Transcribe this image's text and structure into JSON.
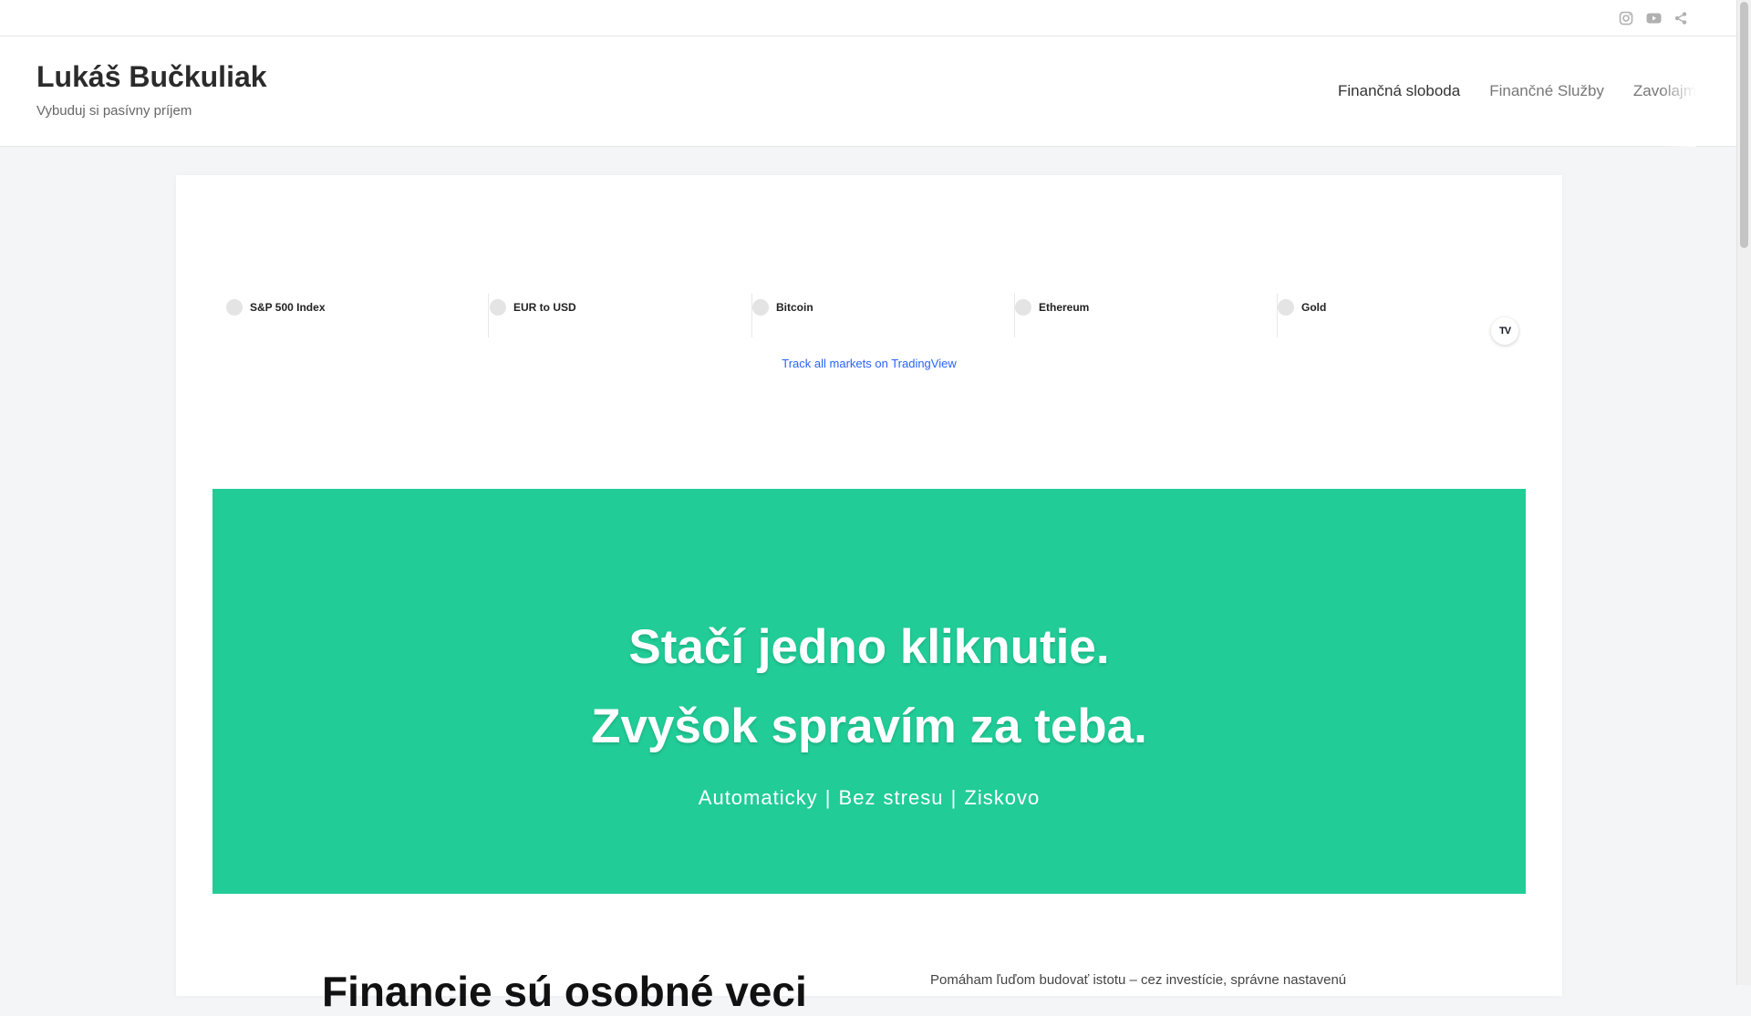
{
  "topbar": {
    "social": [
      {
        "icon": "instagram-icon"
      },
      {
        "icon": "youtube-icon"
      },
      {
        "icon": "share-icon"
      }
    ]
  },
  "header": {
    "title": "Lukáš Bučkuliak",
    "tagline": "Vybuduj si pasívny príjem",
    "nav": [
      {
        "label": "Finančná sloboda",
        "active": true
      },
      {
        "label": "Finančné Služby",
        "active": false
      },
      {
        "label": "Zavolajme si",
        "active": false
      }
    ]
  },
  "ticker": {
    "items": [
      {
        "label": "S&P 500 Index"
      },
      {
        "label": "EUR to USD"
      },
      {
        "label": "Bitcoin"
      },
      {
        "label": "Ethereum"
      },
      {
        "label": "Gold"
      }
    ],
    "logo": "TV",
    "link_text": "Track all markets on TradingView"
  },
  "hero": {
    "line1": "Stačí jedno kliknutie.",
    "line2": "Zvyšok spravím za teba.",
    "subtitle": "Automaticky | Bez stresu | Ziskovo",
    "bg_color": "#21cc97"
  },
  "intro": {
    "heading": "Financie sú osobné veci",
    "text": "Pomáham ľuďom budovať istotu – cez investície, správne nastavenú"
  }
}
